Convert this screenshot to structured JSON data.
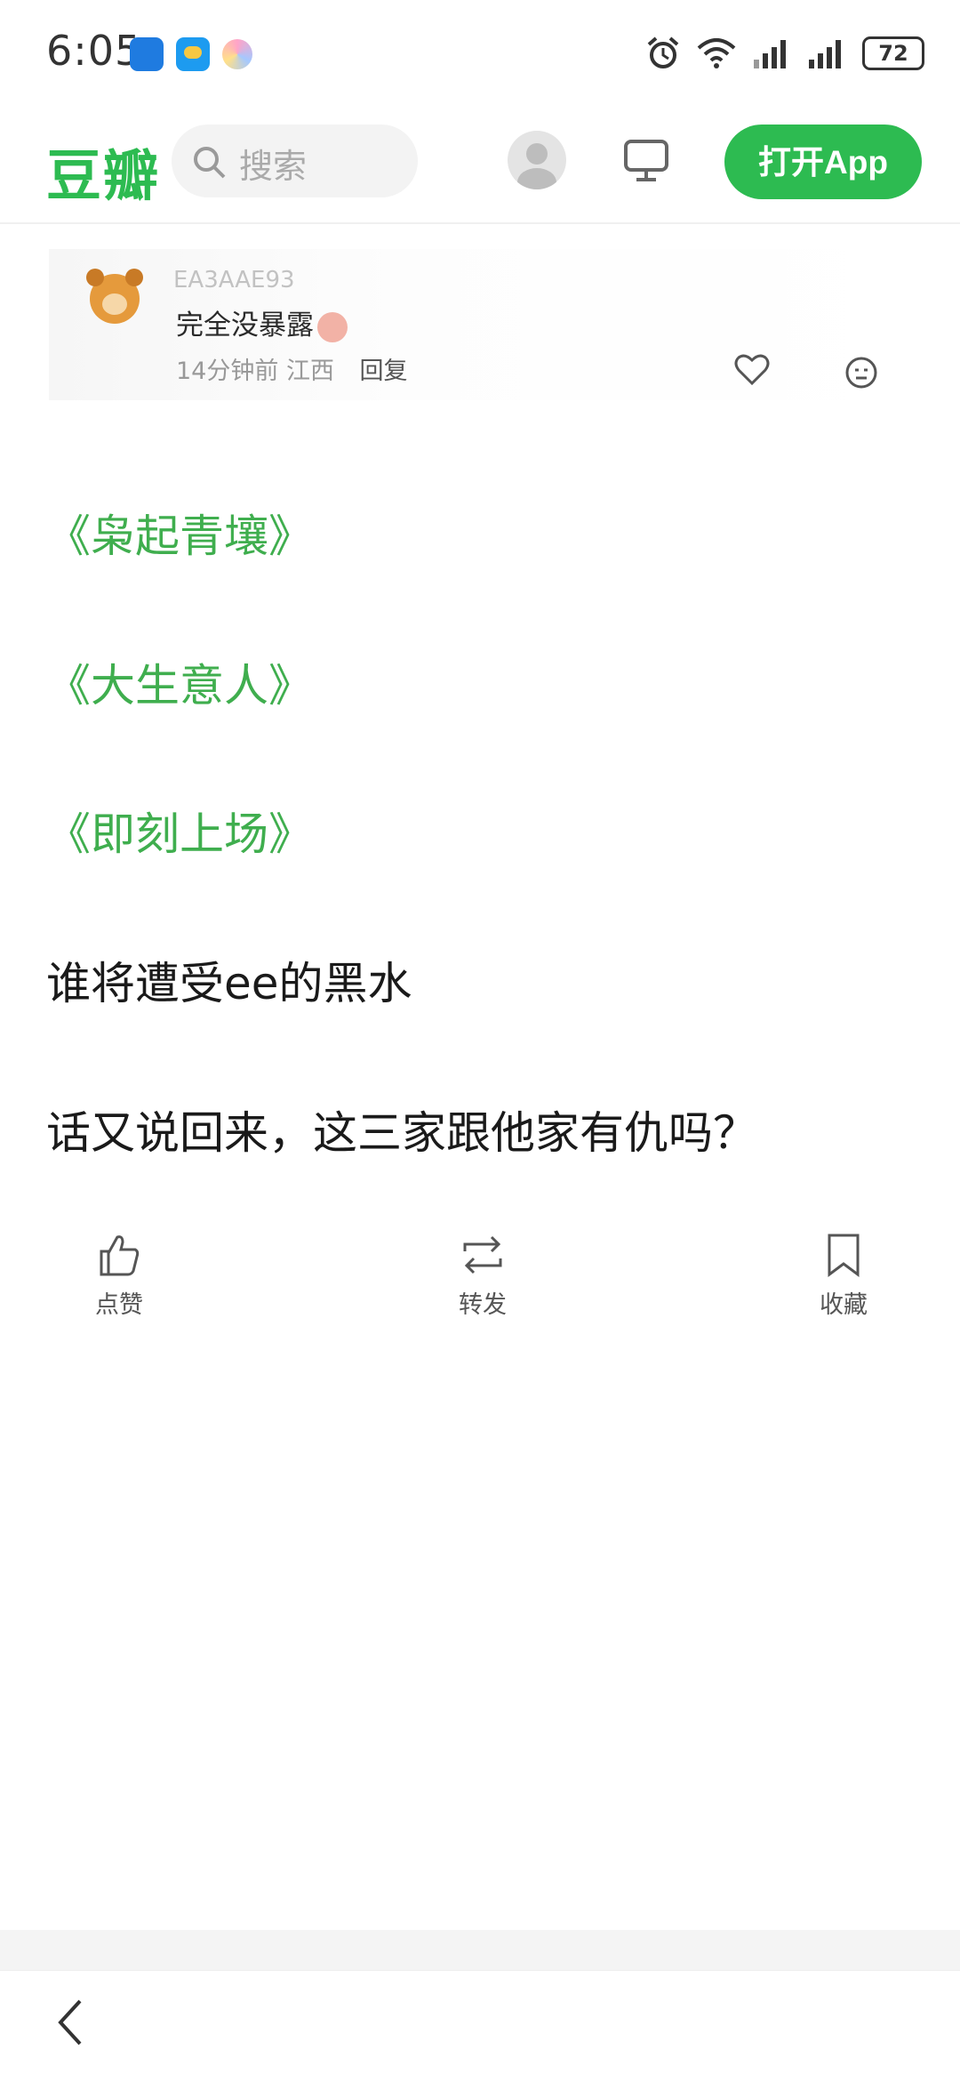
{
  "status_bar": {
    "time": "6:05",
    "battery": "72",
    "icons": [
      "app-notification-icon",
      "weather-app-icon",
      "assistant-icon",
      "alarm-icon",
      "wifi-icon",
      "signal-icon",
      "signal-icon-2",
      "battery-icon"
    ]
  },
  "header": {
    "logo": "豆瓣",
    "search_placeholder": "搜索",
    "open_app_label": "打开App",
    "brand_color": "#2dbb51"
  },
  "comment_image": {
    "user": "EA3AAE93",
    "text": "完全没暴露",
    "time_location": "14分钟前 江西",
    "reply_label": "回复"
  },
  "content": {
    "titles": [
      "《枭起青壤》",
      "《大生意人》",
      "《即刻上场》"
    ],
    "line1": "谁将遭受ee的黑水",
    "line2": "话又说回来，这三家跟他家有仇吗？",
    "link_color": "#3fae4e"
  },
  "actions": {
    "like": "点赞",
    "repost": "转发",
    "collect": "收藏"
  }
}
